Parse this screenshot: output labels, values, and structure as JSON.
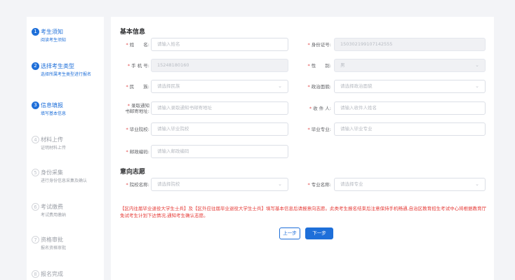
{
  "steps": [
    {
      "num": "1",
      "title": "考生须知",
      "desc": "阅读考生须知",
      "state": "active"
    },
    {
      "num": "2",
      "title": "选择考生类型",
      "desc": "选择所属考生类型进行报名",
      "state": "active"
    },
    {
      "num": "3",
      "title": "信息填报",
      "desc": "填写基本信息",
      "state": "active"
    },
    {
      "num": "4",
      "title": "材料上传",
      "desc": "证明材料上传",
      "state": "inactive"
    },
    {
      "num": "5",
      "title": "身份采集",
      "desc": "进行身份信息采集及确认",
      "state": "inactive"
    },
    {
      "num": "6",
      "title": "考试缴费",
      "desc": "考试费用缴纳",
      "state": "inactive"
    },
    {
      "num": "7",
      "title": "资格审批",
      "desc": "报名资格审批",
      "state": "inactive"
    },
    {
      "num": "8",
      "title": "报名完成",
      "desc": "",
      "state": "inactive"
    }
  ],
  "sections": {
    "basic": "基本信息",
    "intention": "意向志愿"
  },
  "form": {
    "name": {
      "label": "姓　　名:",
      "placeholder": "请输入姓名"
    },
    "id_number": {
      "label": "身份证号:",
      "value": "150302199107142555"
    },
    "phone": {
      "label": "手 机 号:",
      "value": "15248180160"
    },
    "gender": {
      "label": "性　　别:",
      "value": "男"
    },
    "ethnicity": {
      "label": "民　　族:",
      "placeholder": "请选择民族"
    },
    "political": {
      "label": "政治面貌:",
      "placeholder": "请选择政治面貌"
    },
    "mail_address": {
      "label_line1": "录取通知",
      "label_line2": "书邮寄地址:",
      "placeholder": "请输入录取通知书邮寄地址"
    },
    "recipient": {
      "label": "收 件 人:",
      "placeholder": "请输入收件人姓名"
    },
    "graduate_school": {
      "label": "毕业院校:",
      "placeholder": "请输入毕业院校"
    },
    "graduate_major": {
      "label": "毕业专业:",
      "placeholder": "请输入毕业专业"
    },
    "postal_code": {
      "label": "邮政编码:",
      "placeholder": "请输入邮政编码"
    },
    "school": {
      "label": "院校名称:",
      "placeholder": "请选择院校"
    },
    "major": {
      "label": "专业名称:",
      "placeholder": "请选择专业"
    }
  },
  "notice": "【区内往届毕业退役大学生士兵】及【区外应往届毕业退役大学生士兵】填写基本信息后请报意向志愿。此类考生报名结束后注意保持手机畅通,自治区教育招生考试中心将根据教育厅免试考生计划下达情况,通知考生确认志愿。",
  "buttons": {
    "prev": "上一步",
    "next": "下一步"
  },
  "colors": {
    "primary": "#1e6fd9",
    "required": "#e24a4a",
    "notice": "#e53935"
  }
}
